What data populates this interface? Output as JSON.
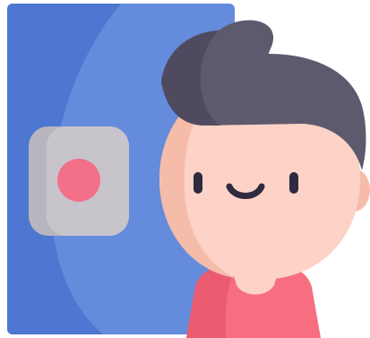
{
  "illustration": {
    "icon": "person-next-to-door-icon",
    "colors": {
      "background": "#ffffff",
      "door_blue": "#5B84D9",
      "door_blue_light": "#6E92DF",
      "door_blue_dark": "#4D77D0",
      "door_panel": "#C8C4CB",
      "door_panel_shadow": "#B9B5BE",
      "door_button": "#F27088",
      "hair": "#5E5A6E",
      "hair_dark": "#4F4A5F",
      "skin": "#FCD3C6",
      "skin_shadow": "#F5BCA9",
      "eyes": "#2F2A3D",
      "mouth": "#2F2A3D",
      "shirt": "#F86E81",
      "shirt_shadow": "#EA5B70",
      "shirt_collar": "#FCD3C6"
    }
  }
}
